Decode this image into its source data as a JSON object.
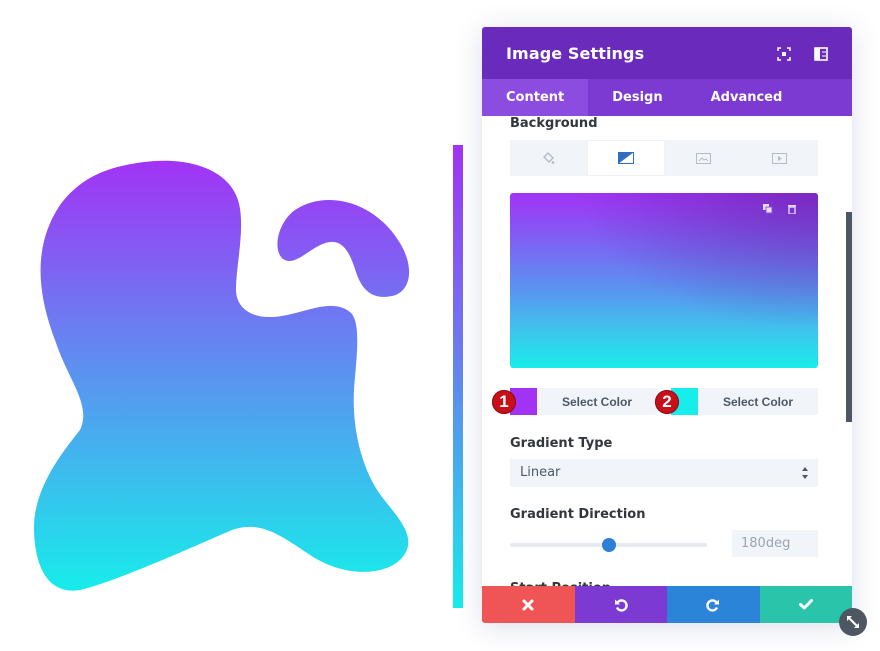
{
  "artwork": {
    "blob_gradient": {
      "top_color": "#a233f5",
      "bottom_color": "#17edea"
    },
    "bar_gradient": {
      "top_color": "#a233f5",
      "bottom_color": "#17edea"
    }
  },
  "modal": {
    "title": "Image Settings",
    "header_icons": [
      "fullscreen-icon",
      "sidebar-layout-icon"
    ],
    "tabs": [
      {
        "label": "Content",
        "active": true
      },
      {
        "label": "Design",
        "active": false
      },
      {
        "label": "Advanced",
        "active": false
      }
    ],
    "background": {
      "label": "Background",
      "type_tabs": [
        {
          "icon": "paint-bucket-icon",
          "active": false
        },
        {
          "icon": "gradient-icon",
          "active": true
        },
        {
          "icon": "image-icon",
          "active": false
        },
        {
          "icon": "video-icon",
          "active": false
        }
      ],
      "preview_icons": [
        "duplicate-icon",
        "trash-icon"
      ],
      "color_stops": [
        {
          "badge": "1",
          "color": "#a233f5",
          "button_label": "Select Color"
        },
        {
          "badge": "2",
          "color": "#17edea",
          "button_label": "Select Color"
        }
      ]
    },
    "gradient_type": {
      "label": "Gradient Type",
      "value": "Linear"
    },
    "gradient_direction": {
      "label": "Gradient Direction",
      "value": "180deg",
      "fraction": 0.5
    },
    "start_position": {
      "label": "Start Position"
    },
    "footer": {
      "cancel_icon": "close-icon",
      "undo_icon": "undo-icon",
      "redo_icon": "redo-icon",
      "save_icon": "check-icon"
    },
    "colors": {
      "header": "#6a2bbd",
      "tabs": "#7c3ad3",
      "cancel": "#ef5555",
      "undo": "#7d3ad2",
      "redo": "#2c84d8",
      "save": "#29c4a9",
      "slider": "#2e7fd6"
    }
  }
}
